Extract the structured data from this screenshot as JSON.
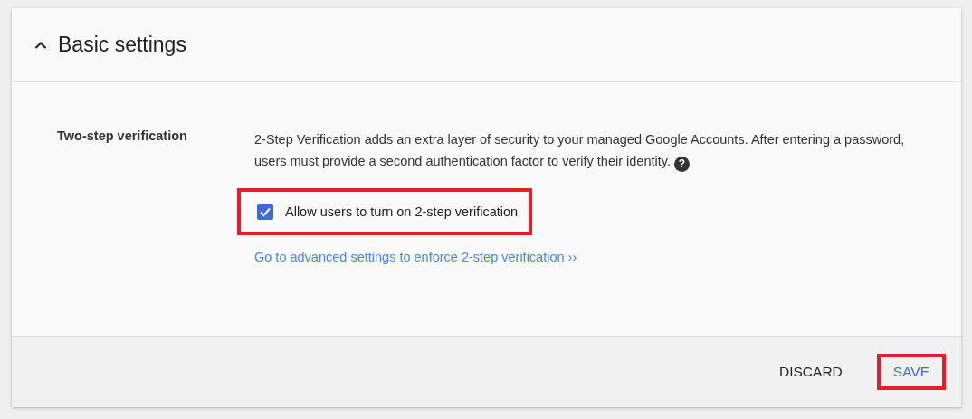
{
  "section": {
    "title": "Basic settings",
    "expanded": true
  },
  "setting": {
    "label": "Two-step verification",
    "description": "2-Step Verification adds an extra layer of security to your managed Google Accounts. After entering a password, users must provide a second authentication factor to verify their identity.",
    "help": "?",
    "checkbox": {
      "label": "Allow users to turn on 2-step verification",
      "checked": true,
      "highlighted": true
    },
    "link": "Go to advanced settings to enforce 2-step verification ››"
  },
  "buttons": [
    {
      "label": "DISCARD",
      "kind": "secondary",
      "highlighted": false
    },
    {
      "label": "SAVE",
      "kind": "primary",
      "highlighted": true
    }
  ]
}
